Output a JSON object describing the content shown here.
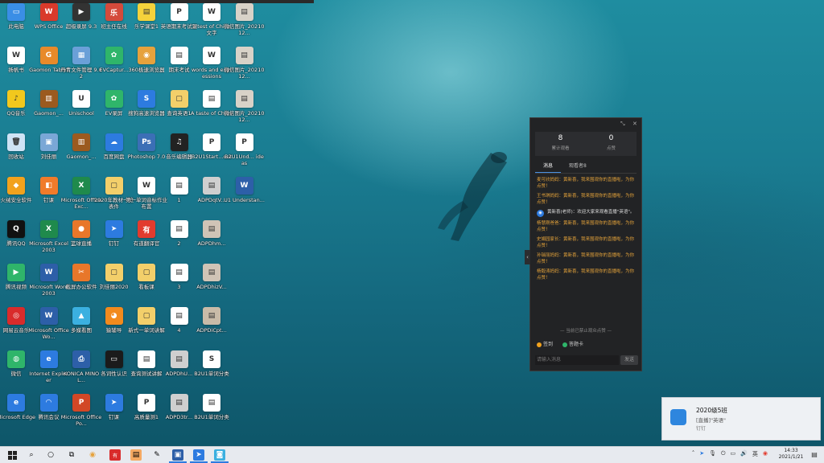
{
  "desktop_icons": [
    {
      "label": "此电脑",
      "icon": "computer-icon",
      "color": "#3a8ee6",
      "glyph": "▭"
    },
    {
      "label": "WPS Office",
      "icon": "wps-office-icon",
      "color": "#d93a2b",
      "glyph": "W"
    },
    {
      "label": "超级录屏 9.3",
      "icon": "screen-recorder-icon",
      "color": "#333333",
      "glyph": "▶"
    },
    {
      "label": "班主任在线",
      "icon": "class-app-icon",
      "color": "#d44a3b",
      "glyph": "乐"
    },
    {
      "label": "乐学课堂1",
      "icon": "document-icon",
      "color": "#f5d23b",
      "glyph": "▤"
    },
    {
      "label": "英语期末考试题",
      "icon": "pdf-icon",
      "color": "#ffffff",
      "glyph": "P"
    },
    {
      "label": "a test of China文字",
      "icon": "word-doc-icon",
      "color": "#ffffff",
      "glyph": "W"
    },
    {
      "label": "微信图片_2021012...",
      "icon": "image-icon",
      "color": "#d8d2c8",
      "glyph": "▤"
    },
    {
      "label": "扬帆书",
      "icon": "word-doc-icon",
      "color": "#ffffff",
      "glyph": "W"
    },
    {
      "label": "Gaomon Tablet",
      "icon": "gaomon-icon",
      "color": "#e88a2a",
      "glyph": "G"
    },
    {
      "label": "丹青文件管理 9.02",
      "icon": "file-manager-icon",
      "color": "#6aa0d8",
      "glyph": "▦"
    },
    {
      "label": "EVCaptur...",
      "icon": "ev-capture-icon",
      "color": "#2fb56a",
      "glyph": "✿"
    },
    {
      "label": "360极速浏览器",
      "icon": "browser-360-icon",
      "color": "#e6a23c",
      "glyph": "◉"
    },
    {
      "label": "期末考试",
      "icon": "document-icon",
      "color": "#ffffff",
      "glyph": "▤"
    },
    {
      "label": "words and expressions",
      "icon": "word-doc-icon",
      "color": "#ffffff",
      "glyph": "W"
    },
    {
      "label": "微信图片_2021012...",
      "icon": "image-icon",
      "color": "#d8d2c8",
      "glyph": "▤"
    },
    {
      "label": "QQ音乐",
      "icon": "qq-music-icon",
      "color": "#f2c81d",
      "glyph": "♪"
    },
    {
      "label": "Gaomon_...",
      "icon": "archive-icon",
      "color": "#9b5a1f",
      "glyph": "▥"
    },
    {
      "label": "Unischool",
      "icon": "unischool-icon",
      "color": "#ffffff",
      "glyph": "U"
    },
    {
      "label": "EV录屏",
      "icon": "ev-record-icon",
      "color": "#2fb56a",
      "glyph": "✿"
    },
    {
      "label": "搜狗高速浏览器",
      "icon": "sogou-browser-icon",
      "color": "#2d7be0",
      "glyph": "S"
    },
    {
      "label": "查询英语1",
      "icon": "folder-icon",
      "color": "#f3cf6a",
      "glyph": "▢"
    },
    {
      "label": "A taste of China",
      "icon": "document-icon",
      "color": "#ffffff",
      "glyph": "▤"
    },
    {
      "label": "微信图片_2021012...",
      "icon": "image-icon",
      "color": "#d8d2c8",
      "glyph": "▤"
    },
    {
      "label": "回收站",
      "icon": "recycle-bin-icon",
      "color": "#cfe3f5",
      "glyph": "🗑"
    },
    {
      "label": "刘佳丽",
      "icon": "photo-icon",
      "color": "#7aa7d6",
      "glyph": "▣"
    },
    {
      "label": "Gaomon_...",
      "icon": "archive-icon",
      "color": "#9b5a1f",
      "glyph": "▥"
    },
    {
      "label": "百度网盘",
      "icon": "baidu-pan-icon",
      "color": "#2d7be0",
      "glyph": "☁"
    },
    {
      "label": "Photoshop 7.0",
      "icon": "photoshop-icon",
      "color": "#3b6fb6",
      "glyph": "Ps"
    },
    {
      "label": "音乐编辑器",
      "icon": "music-editor-icon",
      "color": "#222222",
      "glyph": "♫"
    },
    {
      "label": "B2U1Start...out",
      "icon": "pdf-icon",
      "color": "#ffffff",
      "glyph": "P"
    },
    {
      "label": "B2U1Und... ideas",
      "icon": "pdf-icon",
      "color": "#ffffff",
      "glyph": "P"
    },
    {
      "label": "火绒安全软件",
      "icon": "huorong-icon",
      "color": "#f2a21d",
      "glyph": "◆"
    },
    {
      "label": "钉课",
      "icon": "ding-class-icon",
      "color": "#f07b2a",
      "glyph": "◧"
    },
    {
      "label": "Microsoft Office Exc...",
      "icon": "excel-icon",
      "color": "#1f8a4c",
      "glyph": "X"
    },
    {
      "label": "2020年教材一览表件",
      "icon": "folder-icon",
      "color": "#f3cf6a",
      "glyph": "▢"
    },
    {
      "label": "第一单词音标作业布置",
      "icon": "word-doc-icon",
      "color": "#ffffff",
      "glyph": "W"
    },
    {
      "label": "1",
      "icon": "document-icon",
      "color": "#ffffff",
      "glyph": "▤"
    },
    {
      "label": "ADPDqtV...",
      "icon": "image-icon",
      "color": "#cfcfcf",
      "glyph": "▤"
    },
    {
      "label": "U1 Understan...",
      "icon": "word-doc-icon",
      "color": "#2d5fa8",
      "glyph": "W"
    },
    {
      "label": "腾讯QQ",
      "icon": "qq-icon",
      "color": "#111111",
      "glyph": "Q"
    },
    {
      "label": "Microsoft Excel 2003",
      "icon": "excel-icon",
      "color": "#1f8a4c",
      "glyph": "X"
    },
    {
      "label": "篮球直播",
      "icon": "basketball-icon",
      "color": "#e8772a",
      "glyph": "●"
    },
    {
      "label": "钉钉",
      "icon": "dingtalk-icon",
      "color": "#2d7be0",
      "glyph": "➤"
    },
    {
      "label": "有道翻译官",
      "icon": "youdao-icon",
      "color": "#e23b2e",
      "glyph": "有"
    },
    {
      "label": "2",
      "icon": "document-icon",
      "color": "#ffffff",
      "glyph": "▤"
    },
    {
      "label": "ADPDhm...",
      "icon": "image-icon",
      "color": "#d0c4b6",
      "glyph": "▤"
    },
    {
      "label": "腾讯视频",
      "icon": "tencent-video-icon",
      "color": "#2fb56a",
      "glyph": "▶"
    },
    {
      "label": "Microsoft Word 2003",
      "icon": "word-icon",
      "color": "#2d5fa8",
      "glyph": "W"
    },
    {
      "label": "截屏办公软件",
      "icon": "snip-tool-icon",
      "color": "#e8772a",
      "glyph": "✂"
    },
    {
      "label": "刘佳丽2020",
      "icon": "folder-icon",
      "color": "#f3cf6a",
      "glyph": "▢"
    },
    {
      "label": "看板课",
      "icon": "folder-icon",
      "color": "#f3cf6a",
      "glyph": "▢"
    },
    {
      "label": "3",
      "icon": "document-icon",
      "color": "#ffffff",
      "glyph": "▤"
    },
    {
      "label": "ADPDhizV...",
      "icon": "image-icon",
      "color": "#d0c4b6",
      "glyph": "▤"
    },
    {
      "label": "网易云音乐",
      "icon": "netease-music-icon",
      "color": "#d92b2b",
      "glyph": "◎"
    },
    {
      "label": "Microsoft Office Wo...",
      "icon": "word-icon",
      "color": "#2d5fa8",
      "glyph": "W"
    },
    {
      "label": "多媒看图",
      "icon": "image-viewer-icon",
      "color": "#3bb0e0",
      "glyph": "▲"
    },
    {
      "label": "猿辅导",
      "icon": "monkey-app-icon",
      "color": "#f28a1d",
      "glyph": "◕"
    },
    {
      "label": "新式一单词讲解",
      "icon": "folder-icon",
      "color": "#f3cf6a",
      "glyph": "▢"
    },
    {
      "label": "4",
      "icon": "document-icon",
      "color": "#ffffff",
      "glyph": "▤"
    },
    {
      "label": "ADPDiCpt...",
      "icon": "image-icon",
      "color": "#c9bba8",
      "glyph": "▤"
    },
    {
      "label": "微信",
      "icon": "wechat-icon",
      "color": "#2fb56a",
      "glyph": "◍"
    },
    {
      "label": "Internet Explorer",
      "icon": "ie-icon",
      "color": "#2d7be0",
      "glyph": "e"
    },
    {
      "label": "KONICA MINOL...",
      "icon": "printer-icon",
      "color": "#2d5fa8",
      "glyph": "⎙"
    },
    {
      "label": "各词性认识",
      "icon": "presentation-icon",
      "color": "#1b1b1b",
      "glyph": "▭"
    },
    {
      "label": "查询测试讲解",
      "icon": "document-icon",
      "color": "#ffffff",
      "glyph": "▤"
    },
    {
      "label": "ADPDhU...",
      "icon": "image-icon",
      "color": "#cfcfcf",
      "glyph": "▤"
    },
    {
      "label": "B2U1单词分类",
      "icon": "doc-green-icon",
      "color": "#ffffff",
      "glyph": "S"
    },
    {
      "label": "Microsoft Edge",
      "icon": "edge-icon",
      "color": "#2d7be0",
      "glyph": "e"
    },
    {
      "label": "腾讯会议",
      "icon": "tencent-meeting-icon",
      "color": "#2d7be0",
      "glyph": "◠"
    },
    {
      "label": "Microsoft Office Po...",
      "icon": "powerpoint-icon",
      "color": "#d24726",
      "glyph": "P"
    },
    {
      "label": "钉课",
      "icon": "dingtalk-icon",
      "color": "#2d7be0",
      "glyph": "➤"
    },
    {
      "label": "高质量测1",
      "icon": "pdf-icon",
      "color": "#ffffff",
      "glyph": "P"
    },
    {
      "label": "ADPD3tr...",
      "icon": "image-icon",
      "color": "#cfcfcf",
      "glyph": "▤"
    },
    {
      "label": "B2U1单词分类",
      "icon": "document-icon",
      "color": "#ffffff",
      "glyph": "▤"
    }
  ],
  "chat_panel": {
    "stat_views": "8",
    "stat_views_label": "累计观看",
    "stat_likes": "0",
    "stat_likes_label": "点赞",
    "tab_messages": "消息",
    "tab_viewers": "观看者8",
    "messages": [
      {
        "type": "gold",
        "text": "麦可欣妈妈：黄新喜，我来围观你的直播啦，为你点赞！"
      },
      {
        "type": "gold",
        "text": "王书琪妈妈：黄新喜，我来围观你的直播啦，为你点赞！"
      },
      {
        "type": "system",
        "text": "黄新喜(老师)：欢迎大家来观看直播\"英语\"。"
      },
      {
        "type": "gold",
        "text": "杨慧刚爸爸：黄新喜，我来围观你的直播啦，为你点赞！"
      },
      {
        "type": "gold",
        "text": "史娟园家长：黄新喜，我来围观你的直播啦，为你点赞！"
      },
      {
        "type": "gold",
        "text": "孙瑞丽妈妈：黄新喜，我来围观你的直播啦，为你点赞！"
      },
      {
        "type": "gold",
        "text": "杨毅涛妈妈：黄新喜，我来围观你的直播啦，为你点赞！"
      }
    ],
    "divider": "— 当前已禁止观众点赞 —",
    "option_signin": "签到",
    "option_answer": "答题卡",
    "input_placeholder": "请输入消息",
    "send_label": "发送"
  },
  "toast": {
    "title": "2020级5班",
    "subtitle": "[直播]\"英语\"",
    "detail": "钉钉"
  },
  "taskbar": {
    "time": "14:33",
    "date": "2021/1/21",
    "colors": {
      "accent": "#2d7be0"
    }
  }
}
